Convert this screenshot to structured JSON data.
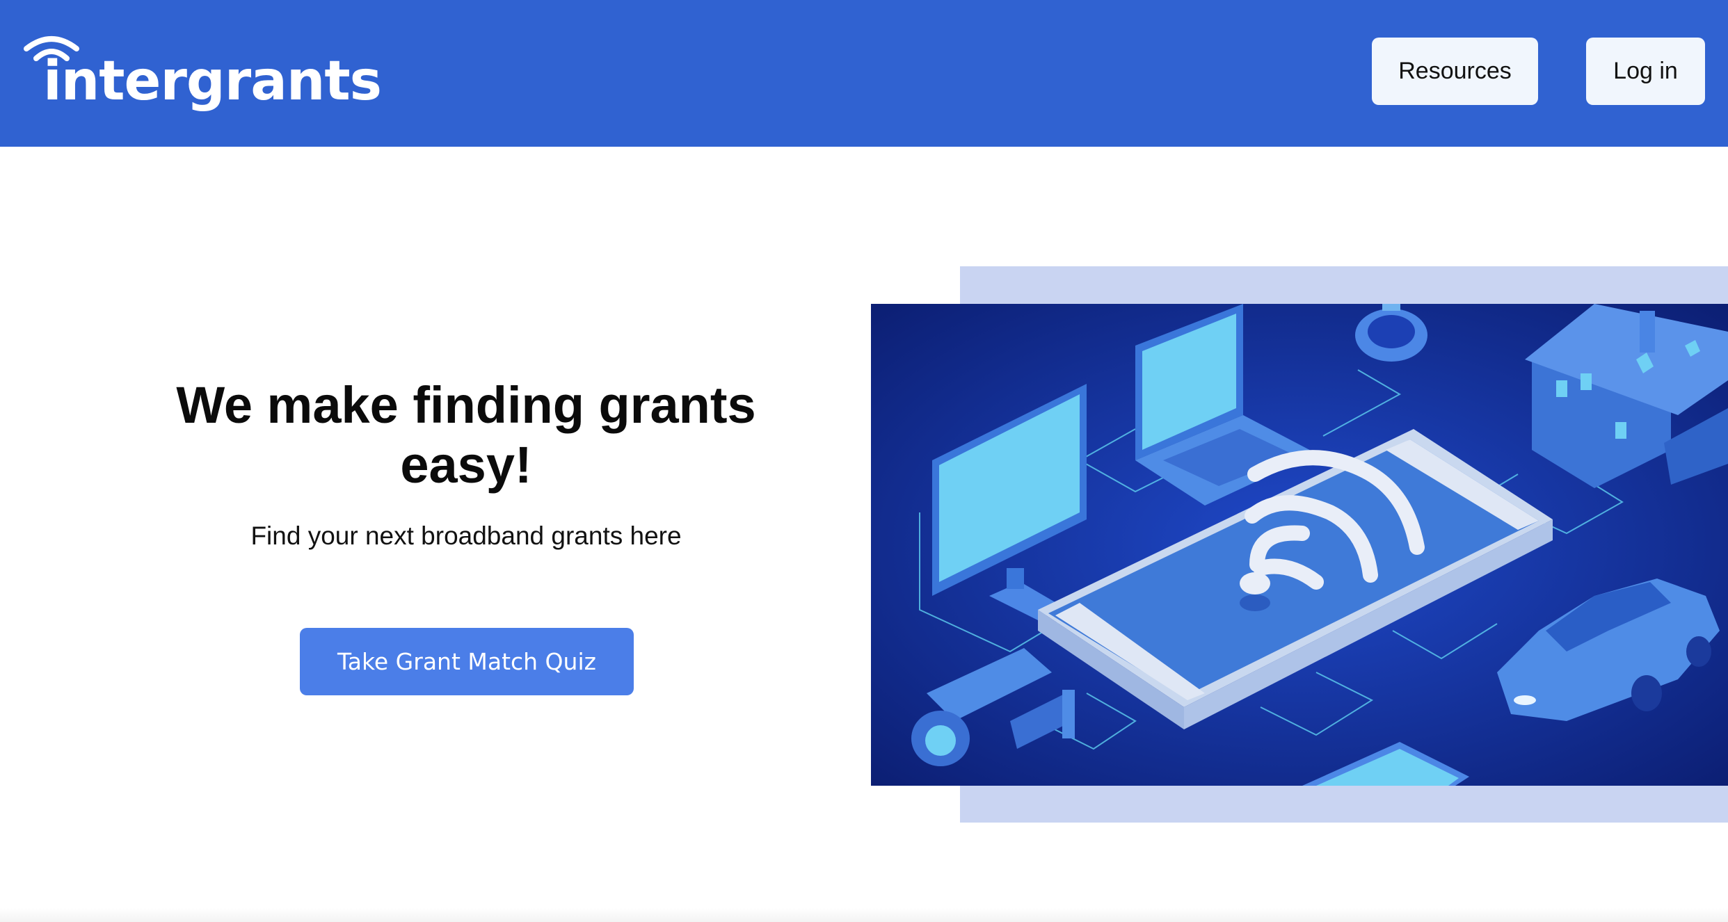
{
  "header": {
    "brand": "intergrants",
    "nav": {
      "resources_label": "Resources",
      "login_label": "Log in"
    },
    "brand_color": "#3062d1"
  },
  "hero": {
    "title": "We make finding grants easy!",
    "subtitle": "Find your next broadband grants here",
    "cta_label": "Take Grant Match Quiz",
    "cta_color": "#4b7ee8",
    "illustration": {
      "icon_names": [
        "smartphone-wifi-icon",
        "monitor-icon",
        "laptop-icon",
        "smartwatch-icon",
        "house-icon",
        "car-icon",
        "security-camera-icon",
        "tablet-icon"
      ],
      "backdrop_color": "#c9d4f2",
      "background_color": "#0f2a8a"
    }
  }
}
